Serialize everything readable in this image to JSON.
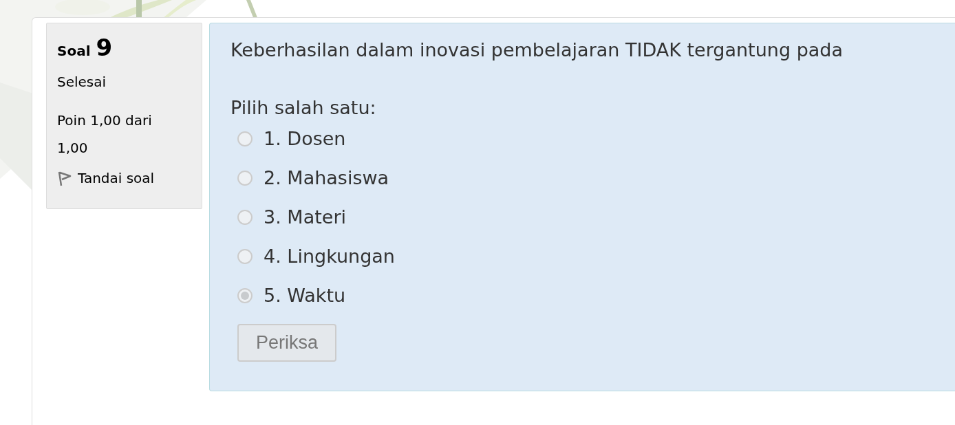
{
  "info": {
    "label": "Soal",
    "number": "9",
    "state": "Selesai",
    "grade": "Poin 1,00 dari 1,00",
    "flag": {
      "label": "Tandai soal",
      "flagged": false
    }
  },
  "question": {
    "text": "Keberhasilan dalam inovasi pembelajaran TIDAK tergantung pada",
    "prompt": "Pilih salah satu:",
    "options": [
      {
        "label": "1. Dosen",
        "selected": false,
        "disabled": true
      },
      {
        "label": "2. Mahasiswa",
        "selected": false,
        "disabled": true
      },
      {
        "label": "3. Materi",
        "selected": false,
        "disabled": true
      },
      {
        "label": "4. Lingkungan",
        "selected": false,
        "disabled": true
      },
      {
        "label": "5. Waktu",
        "selected": true,
        "disabled": true
      }
    ],
    "button": {
      "label": "Periksa",
      "disabled": true
    }
  }
}
